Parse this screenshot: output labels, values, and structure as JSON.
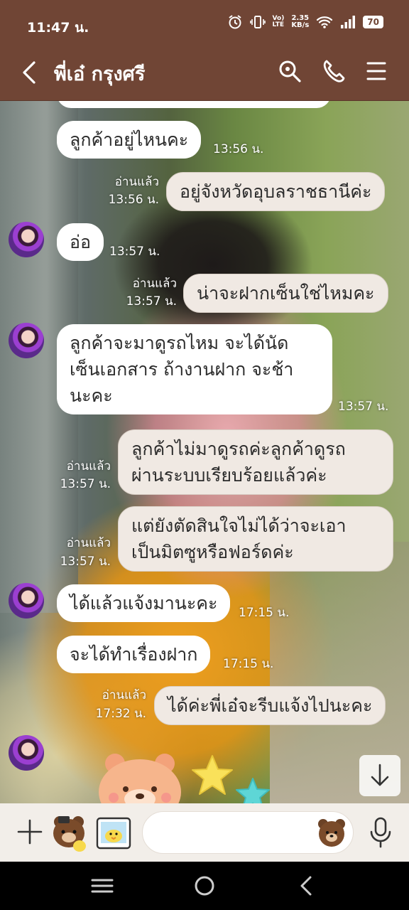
{
  "status_bar": {
    "time": "11:47 น.",
    "network_label": "LTE",
    "volte_label": "Vo)",
    "speed_value": "2.35",
    "speed_unit": "KB/s",
    "battery": "70"
  },
  "header": {
    "title": "พี่เอ๋ กรุงศรี",
    "icons": [
      "back-icon",
      "search-icon",
      "phone-icon",
      "menu-icon"
    ]
  },
  "messages": [
    {
      "dir": "in",
      "text": "ลูกค้าอยู่ไหนคะ",
      "time": "13:56 น.",
      "avatar": false
    },
    {
      "dir": "out",
      "text": "อยู่จังหวัดอุบลราชธานีค่ะ",
      "time": "13:56 น.",
      "read": "อ่านแล้ว"
    },
    {
      "dir": "in",
      "text": "อ่อ",
      "time": "13:57 น.",
      "avatar": true
    },
    {
      "dir": "out",
      "text": "น่าจะฝากเซ็นใช่ไหมคะ",
      "time": "13:57 น.",
      "read": "อ่านแล้ว"
    },
    {
      "dir": "in",
      "lines": [
        "ลูกค้าจะมาดูรถไหม จะได้นัด",
        "เซ็นเอกสาร ถ้างานฝาก จะช้า",
        "นะคะ"
      ],
      "time": "13:57 น.",
      "avatar": true
    },
    {
      "dir": "out",
      "lines": [
        "ลูกค้าไม่มาดูรถค่ะลูกค้าดูรถ",
        "ผ่านระบบเรียบร้อยแล้วค่ะ"
      ],
      "time": "13:57 น.",
      "read": "อ่านแล้ว"
    },
    {
      "dir": "out",
      "lines": [
        "แต่ยังตัดสินใจไม่ได้ว่าจะเอา",
        "เป็นมิตซูหรือฟอร์ดค่ะ"
      ],
      "time": "13:57 น.",
      "read": "อ่านแล้ว"
    },
    {
      "dir": "in",
      "text": "ได้แล้วแจ้งมานะคะ",
      "time": "17:15 น.",
      "avatar": true
    },
    {
      "dir": "in",
      "text": "จะได้ทำเรื่องฝาก",
      "time": "17:15 น.",
      "avatar": false
    },
    {
      "dir": "out",
      "text": "ได้ค่ะพี่เอ๋จะรีบแจ้งไปนะคะ",
      "time": "17:32 น.",
      "read": "อ่านแล้ว"
    }
  ],
  "composer": {
    "placeholder": ""
  },
  "colors": {
    "header_bg": "#704535",
    "bubble_in": "#ffffff",
    "bubble_out": "#f0e9e3",
    "composer_bg": "#f2eee9"
  }
}
